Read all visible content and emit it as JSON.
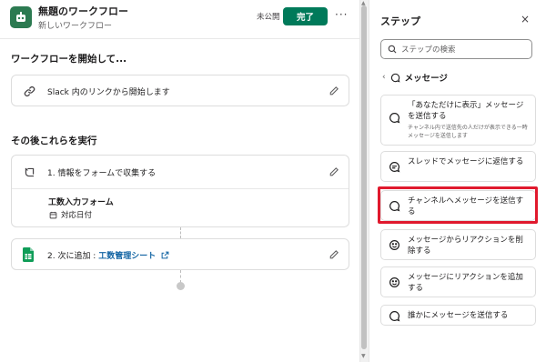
{
  "header": {
    "title": "無題のワークフロー",
    "subtitle": "新しいワークフロー",
    "status": "未公開",
    "done_label": "完了",
    "more_label": "···"
  },
  "start_section": {
    "title": "ワークフローを開始して...",
    "trigger_label": "Slack 内のリンクから開始します"
  },
  "then_section": {
    "title": "その後これらを実行",
    "step1_label": "1. 情報をフォームで収集する",
    "form_name": "工数入力フォーム",
    "form_field": "対応日付",
    "step2_prefix": "2. 次に追加 : ",
    "step2_link": "工数管理シート"
  },
  "panel": {
    "title": "ステップ",
    "close_label": "×",
    "search_placeholder": "ステップの検索",
    "category": "メッセージ",
    "steps": [
      {
        "label": "「あなただけに表示」メッセージを送信する",
        "desc": "チャンネル内で送信先の人だけが表示できる一時メッセージを送信します"
      },
      {
        "label": "スレッドでメッセージに返信する"
      },
      {
        "label": "チャンネルへメッセージを送信する"
      },
      {
        "label": "メッセージからリアクションを削除する"
      },
      {
        "label": "メッセージにリアクションを追加する"
      },
      {
        "label": "誰かにメッセージを送信する"
      }
    ]
  },
  "colors": {
    "primary_green": "#007a5a",
    "link_blue": "#1264a3",
    "highlight_red": "#e0192d"
  }
}
